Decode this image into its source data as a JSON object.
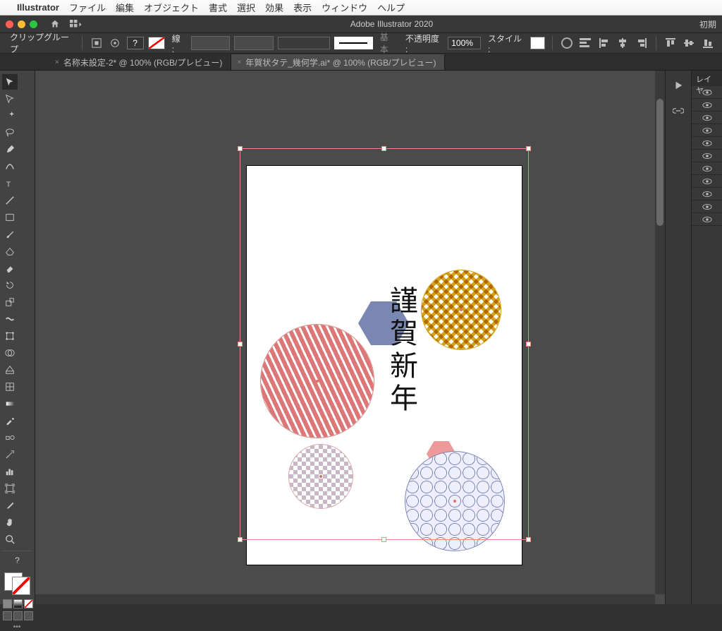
{
  "menu": {
    "apple": "",
    "app": "Illustrator",
    "items": [
      "ファイル",
      "編集",
      "オブジェクト",
      "書式",
      "選択",
      "効果",
      "表示",
      "ウィンドウ",
      "ヘルプ"
    ]
  },
  "titlebar": {
    "title": "Adobe Illustrator 2020",
    "right": "初期"
  },
  "control": {
    "selection_label": "クリップグループ",
    "stroke_label": "線 :",
    "stroke_style_label": "基本",
    "opacity_label": "不透明度 :",
    "opacity_value": "100%",
    "style_label": "スタイル :"
  },
  "tabs": [
    {
      "label": "名称未設定-2* @ 100% (RGB/プレビュー)",
      "active": false
    },
    {
      "label": "年賀状タテ_幾何学.ai* @ 100% (RGB/プレビュー)",
      "active": true
    }
  ],
  "artwork": {
    "vtext": "謹賀新年"
  },
  "panel": {
    "layers_label": "レイヤー"
  }
}
